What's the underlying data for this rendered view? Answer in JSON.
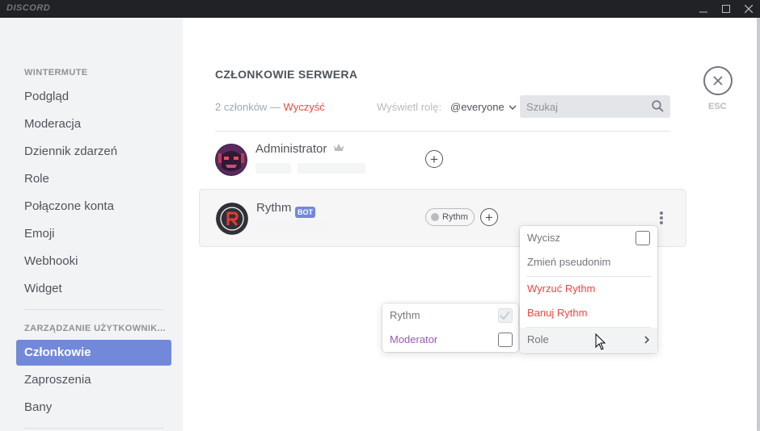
{
  "app": {
    "logo": "DISCORD"
  },
  "colors": {
    "accent": "#7289da",
    "danger": "#f04747",
    "moderator": "#9b59b6"
  },
  "sidebar": {
    "server_header": "WINTERMUTE",
    "server_items": [
      {
        "label": "Podgląd"
      },
      {
        "label": "Moderacja"
      },
      {
        "label": "Dziennik zdarzeń"
      },
      {
        "label": "Role"
      },
      {
        "label": "Połączone konta"
      },
      {
        "label": "Emoji"
      },
      {
        "label": "Webhooki"
      },
      {
        "label": "Widget"
      }
    ],
    "user_header": "ZARZĄDZANIE UŻYTKOWNIK...",
    "user_items": [
      {
        "label": "Członkowie",
        "active": true
      },
      {
        "label": "Zaproszenia"
      },
      {
        "label": "Bany"
      }
    ]
  },
  "main": {
    "title": "CZŁONKOWIE SERWERA",
    "count": "2 członków",
    "count_sep": " — ",
    "clear": "Wyczyść",
    "role_filter_label": "Wyświetl rolę:",
    "role_filter_value": "@everyone",
    "search_placeholder": "Szukaj",
    "close_label": "ESC",
    "add_role_symbol": "+"
  },
  "members": [
    {
      "name": "Administrator",
      "owner": true,
      "icon": "crown-icon"
    },
    {
      "name": "Rythm",
      "tag": "BOT",
      "roles": [
        "Rythm"
      ]
    }
  ],
  "context_menu": {
    "items": [
      {
        "label": "Wycisz",
        "type": "checkbox",
        "checked": false
      },
      {
        "label": "Zmień pseudonim"
      },
      {
        "label": "Wyrzuć Rythm",
        "danger": true
      },
      {
        "label": "Banuj Rythm",
        "danger": true
      },
      {
        "label": "Role",
        "submenu": true
      }
    ]
  },
  "roles_submenu": {
    "items": [
      {
        "label": "Rythm",
        "checked": true,
        "disabled": true
      },
      {
        "label": "Moderator",
        "checked": false,
        "color": "#9b59b6"
      }
    ]
  }
}
